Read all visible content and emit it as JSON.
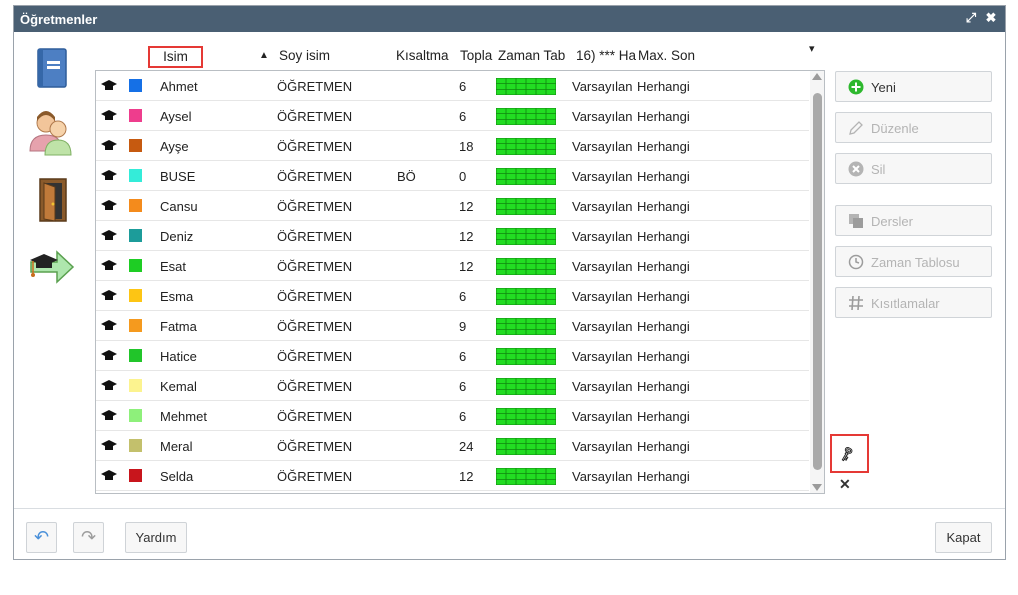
{
  "window": {
    "title": "Öğretmenler",
    "title_buttons": {
      "expand": "⤢",
      "close": "✖"
    }
  },
  "sidebar_icons": [
    "book-icon",
    "teachers-icon",
    "door-icon",
    "graduation-cap-arrow-icon"
  ],
  "table": {
    "columns": {
      "first_name": "Isim",
      "sort_arrow": "▲",
      "last_name": "Soy isim",
      "short": "Kısaltma",
      "total": "Topla",
      "timetable": "Zaman Tab",
      "h16": "16) *** Ha",
      "max": "Max. Son"
    },
    "column_menu_icon": "▾",
    "rows": [
      {
        "first": "Ahmet",
        "last": "ÖĞRETMEN",
        "short": "",
        "total": "6",
        "tt_def": "Varsayılan",
        "any": "Herhangi",
        "color": "#1570e6"
      },
      {
        "first": "Aysel",
        "last": "ÖĞRETMEN",
        "short": "",
        "total": "6",
        "tt_def": "Varsayılan",
        "any": "Herhangi",
        "color": "#ee3d8d"
      },
      {
        "first": "Ayşe",
        "last": "ÖĞRETMEN",
        "short": "",
        "total": "18",
        "tt_def": "Varsayılan",
        "any": "Herhangi",
        "color": "#c65a10"
      },
      {
        "first": "BUSE",
        "last": "ÖĞRETMEN",
        "short": "BÖ",
        "total": "0",
        "tt_def": "Varsayılan",
        "any": "Herhangi",
        "color": "#34ecd9"
      },
      {
        "first": "Cansu",
        "last": "ÖĞRETMEN",
        "short": "",
        "total": "12",
        "tt_def": "Varsayılan",
        "any": "Herhangi",
        "color": "#f48b1c"
      },
      {
        "first": "Deniz",
        "last": "ÖĞRETMEN",
        "short": "",
        "total": "12",
        "tt_def": "Varsayılan",
        "any": "Herhangi",
        "color": "#1c9c9a"
      },
      {
        "first": "Esat",
        "last": "ÖĞRETMEN",
        "short": "",
        "total": "12",
        "tt_def": "Varsayılan",
        "any": "Herhangi",
        "color": "#1ecd24"
      },
      {
        "first": "Esma",
        "last": "ÖĞRETMEN",
        "short": "",
        "total": "6",
        "tt_def": "Varsayılan",
        "any": "Herhangi",
        "color": "#fdc514"
      },
      {
        "first": "Fatma",
        "last": "ÖĞRETMEN",
        "short": "",
        "total": "9",
        "tt_def": "Varsayılan",
        "any": "Herhangi",
        "color": "#f59a1e"
      },
      {
        "first": "Hatice",
        "last": "ÖĞRETMEN",
        "short": "",
        "total": "6",
        "tt_def": "Varsayılan",
        "any": "Herhangi",
        "color": "#21c52a"
      },
      {
        "first": "Kemal",
        "last": "ÖĞRETMEN",
        "short": "",
        "total": "6",
        "tt_def": "Varsayılan",
        "any": "Herhangi",
        "color": "#fcf38f"
      },
      {
        "first": "Mehmet",
        "last": "ÖĞRETMEN",
        "short": "",
        "total": "6",
        "tt_def": "Varsayılan",
        "any": "Herhangi",
        "color": "#8ef07b"
      },
      {
        "first": "Meral",
        "last": "ÖĞRETMEN",
        "short": "",
        "total": "24",
        "tt_def": "Varsayılan",
        "any": "Herhangi",
        "color": "#c3c06c"
      },
      {
        "first": "Selda",
        "last": "ÖĞRETMEN",
        "short": "",
        "total": "12",
        "tt_def": "Varsayılan",
        "any": "Herhangi",
        "color": "#c8151c"
      }
    ]
  },
  "actions": {
    "new": "Yeni",
    "edit": "Düzenle",
    "delete": "Sil",
    "lessons": "Dersler",
    "timetable": "Zaman Tablosu",
    "constraints": "Kısıtlamalar"
  },
  "key_icon_glyph": "🗝",
  "clear_icon_glyph": "✕",
  "bottom": {
    "undo_glyph": "↶",
    "redo_glyph": "↷",
    "help": "Yardım",
    "close": "Kapat"
  },
  "colors": {
    "titlebar": "#4a5f73",
    "new_icon": "#2eb82e",
    "timetable_green": "#22dd22",
    "highlight_red": "#e53935"
  }
}
